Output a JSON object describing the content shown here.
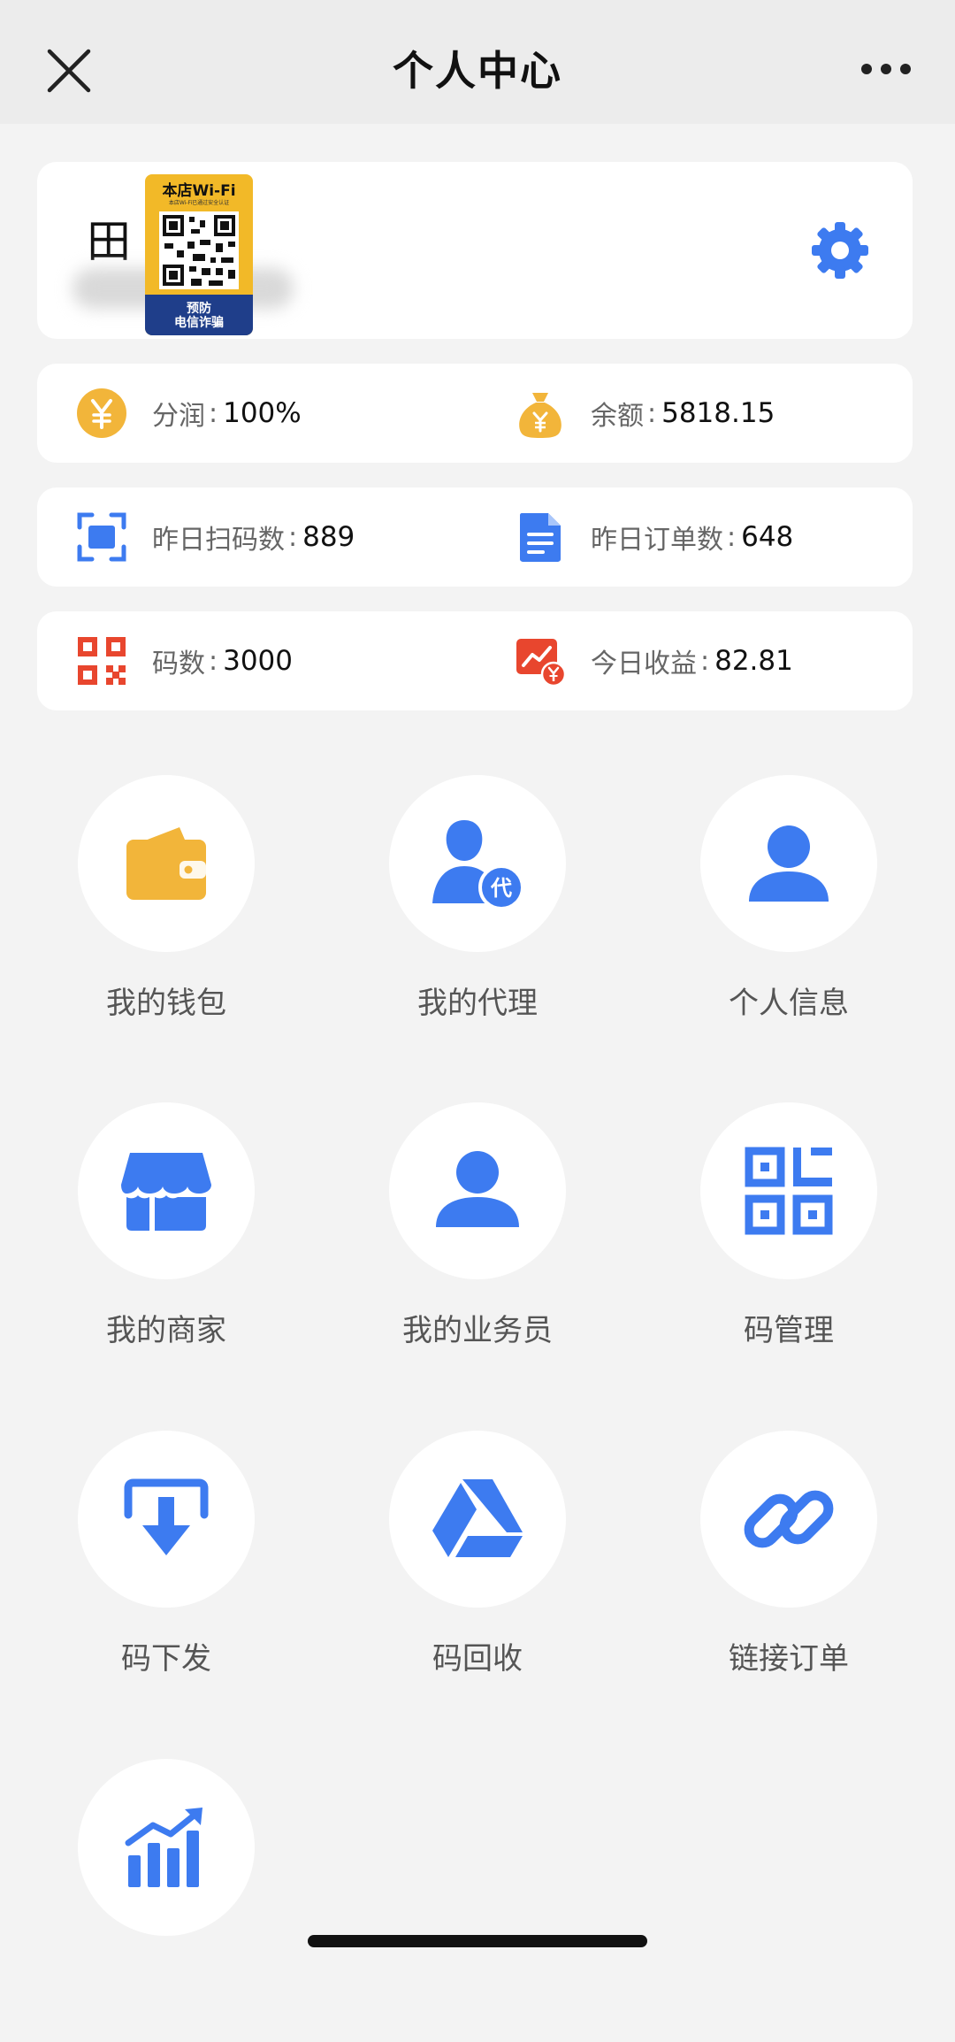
{
  "header": {
    "title": "个人中心"
  },
  "profile": {
    "avatar_char": "田",
    "badge": {
      "title": "本店Wi-Fi",
      "subtitle": "本店Wi-Fi已通过安全认证",
      "banner": "预防\n电信诈骗"
    }
  },
  "stats": {
    "share": {
      "label": "分润",
      "value": "100%"
    },
    "balance": {
      "label": "余额",
      "value": "5818.15"
    },
    "scans": {
      "label": "昨日扫码数",
      "value": "889"
    },
    "orders": {
      "label": "昨日订单数",
      "value": "648"
    },
    "codes": {
      "label": "码数",
      "value": "3000"
    },
    "income": {
      "label": "今日收益",
      "value": "82.81"
    }
  },
  "menu": [
    {
      "label": "我的钱包"
    },
    {
      "label": "我的代理"
    },
    {
      "label": "个人信息"
    },
    {
      "label": "我的商家"
    },
    {
      "label": "我的业务员"
    },
    {
      "label": "码管理"
    },
    {
      "label": "码下发"
    },
    {
      "label": "码回收"
    },
    {
      "label": "链接订单"
    },
    {
      "label": ""
    }
  ],
  "colors": {
    "accent": "#3d7bf0",
    "gold": "#f2b53a",
    "red": "#e8462e",
    "background": "#f3f3f3"
  }
}
